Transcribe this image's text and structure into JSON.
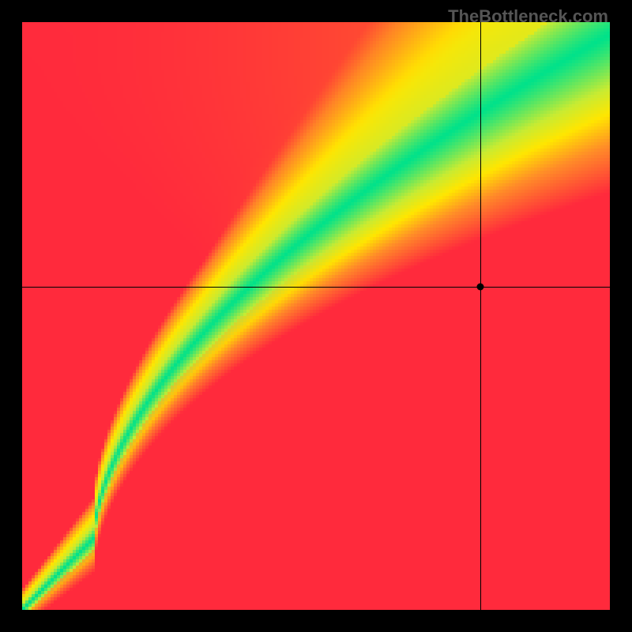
{
  "watermark": "TheBottleneck.com",
  "chart_data": {
    "type": "heatmap",
    "title": "",
    "xlabel": "",
    "ylabel": "",
    "xlim": [
      0,
      100
    ],
    "ylim": [
      0,
      100
    ],
    "grid": false,
    "colormap": "green_yellow_red",
    "diagonal_curve": {
      "description": "optimal pairing curve (green band) from bottom-left to top-right, gamma>1",
      "gamma": 0.58,
      "bend_point": {
        "x": 12,
        "y": 12
      },
      "band_width_start": 2,
      "band_width_end": 18
    },
    "crosshair": {
      "x": 78,
      "y": 55
    },
    "marker": {
      "x": 78,
      "y": 55
    },
    "corner_colors": {
      "top_left": "#ff2a3c",
      "top_right": "#ffe600",
      "bottom_left": "#ff2a3c",
      "bottom_right": "#ff2a3c",
      "band": "#00e28a"
    }
  }
}
